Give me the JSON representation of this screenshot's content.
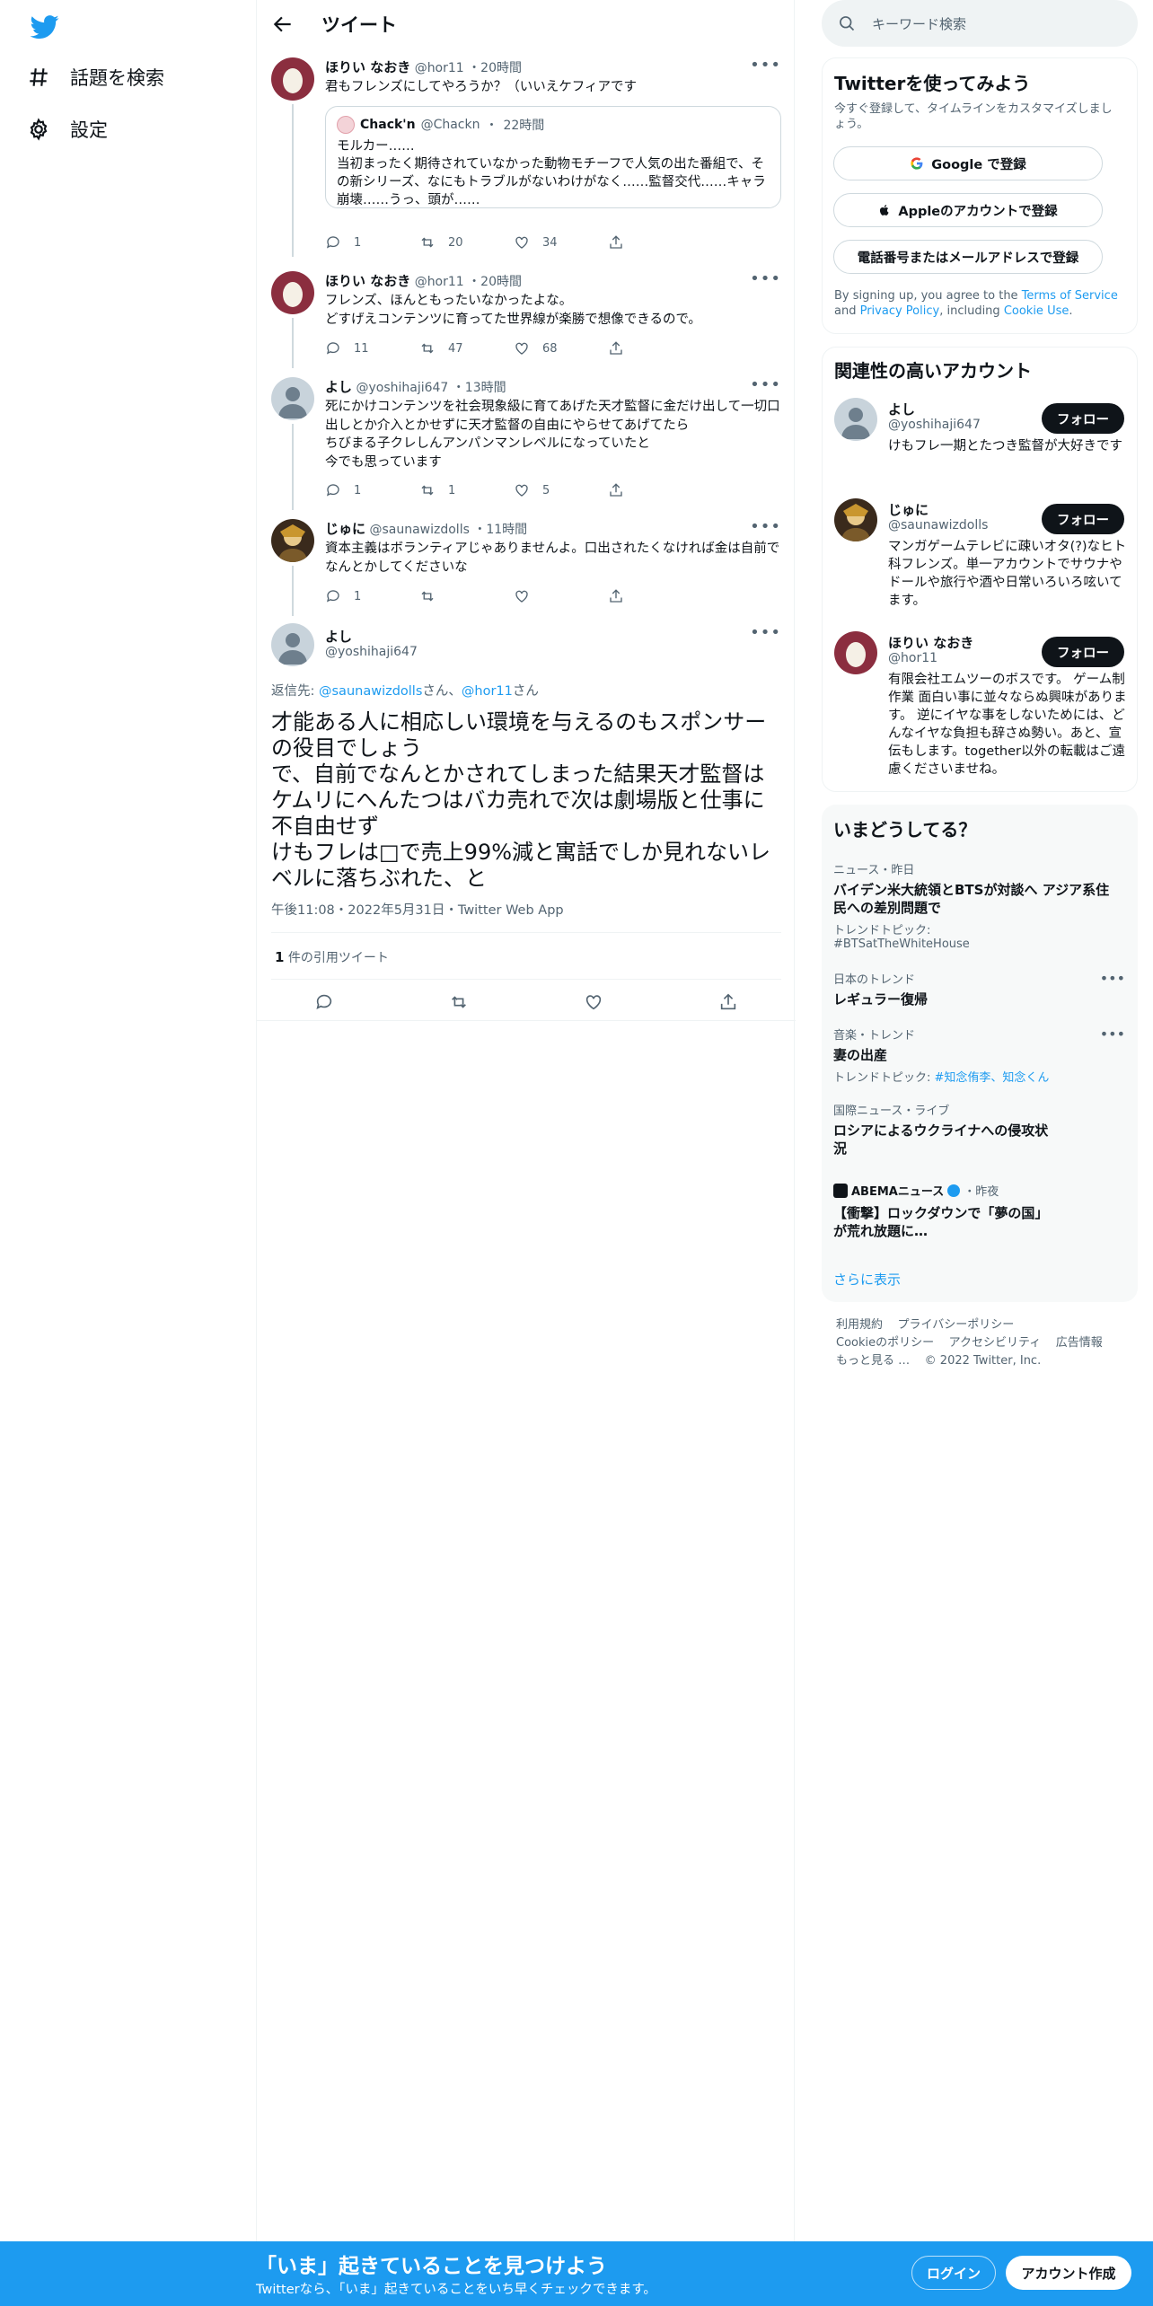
{
  "colors": {
    "accent": "#1d9bf0",
    "text": "#0f1419",
    "muted": "#536471"
  },
  "nav": {
    "items": [
      {
        "label": "話題を検索",
        "icon": "hashtag-icon"
      },
      {
        "label": "設定",
        "icon": "gear-icon"
      }
    ]
  },
  "header": {
    "title": "ツイート"
  },
  "thread": [
    {
      "name": "ほりい なおき",
      "handle": "@hor11",
      "time": "20時間",
      "text": "君もフレンズにしてやろうか？（いいえケフィアです",
      "quote": {
        "name": "Chack'n",
        "handle": "@Chackn",
        "time": "22時間",
        "text": "モルカー……\n当初まったく期待されていなかった動物モチーフで人気の出た番組で、その新シリーズ、なにもトラブルがないわけがなく……監督交代……キャラ崩壊……うっ、頭が……"
      },
      "replies": "1",
      "retweets": "20",
      "likes": "34"
    },
    {
      "name": "ほりい なおき",
      "handle": "@hor11",
      "time": "20時間",
      "text": "フレンズ、ほんともったいなかったよな。\nどすげえコンテンツに育ってた世界線が楽勝で想像できるので。",
      "replies": "11",
      "retweets": "47",
      "likes": "68"
    },
    {
      "name": "よし",
      "handle": "@yoshihaji647",
      "time": "13時間",
      "text": "死にかけコンテンツを社会現象級に育てあげた天才監督に金だけ出して一切口出しとか介入とかせずに天才監督の自由にやらせてあげてたら\nちびまる子クレしんアンパンマンレベルになっていたと\n今でも思っています",
      "replies": "1",
      "retweets": "1",
      "likes": "5"
    },
    {
      "name": "じゅに",
      "handle": "@saunawizdolls",
      "time": "11時間",
      "text": "資本主義はボランティアじゃありませんよ。口出されたくなければ金は自前でなんとかしてくださいな",
      "replies": "1",
      "retweets": "",
      "likes": ""
    }
  ],
  "main_tweet": {
    "name": "よし",
    "handle": "@yoshihaji647",
    "reply_to_prefix": "返信先: ",
    "reply_to_1": "@saunawizdolls",
    "reply_to_mid": "さん、",
    "reply_to_2": "@hor11",
    "reply_to_suffix": "さん",
    "text": "才能ある人に相応しい環境を与えるのもスポンサーの役目でしょう\nで、自前でなんとかされてしまった結果天才監督はケムリにへんたつはバカ売れで次は劇場版と仕事に不自由せず\nけもフレは□で売上99%減と寓話でしか見れないレベルに落ちぶれた、と",
    "timestamp": "午後11:08・2022年5月31日・Twitter Web App",
    "quote_count": "1",
    "quote_label": "件の引用ツイート"
  },
  "search": {
    "placeholder": "キーワード検索"
  },
  "signup_card": {
    "title": "Twitterを使ってみよう",
    "subtitle": "今すぐ登録して、タイムラインをカスタマイズしましょう。",
    "google": "Google で登録",
    "apple": "Appleのアカウントで登録",
    "phone": "電話番号またはメールアドレスで登録",
    "terms_1": "By signing up, you agree to the ",
    "terms_tos": "Terms of Service",
    "terms_2": " and ",
    "terms_privacy": "Privacy Policy",
    "terms_3": ", including ",
    "terms_cookie": "Cookie Use",
    "terms_4": "."
  },
  "relevant": {
    "title": "関連性の高いアカウント",
    "follow_label": "フォロー",
    "accounts": [
      {
        "name": "よし",
        "handle": "@yoshihaji647",
        "bio": "けもフレ一期とたつき監督が大好きです"
      },
      {
        "name": "じゅに",
        "handle": "@saunawizdolls",
        "bio": "マンガゲームテレビに疎いオタ(?)なヒト科フレンズ。単一アカウントでサウナやドールや旅行や酒や日常いろいろ呟いてます。"
      },
      {
        "name": "ほりい なおき",
        "handle": "@hor11",
        "bio": "有限会社エムツーのボスです。 ゲーム制作業 面白い事に並々ならぬ興味があります。 逆にイヤな事をしないためには、どんなイヤな負担も辞さぬ勢い。あと、宣伝もします。together以外の転載はご遠慮くださいませね。"
      }
    ]
  },
  "trends": {
    "title": "いまどうしてる？",
    "items": [
      {
        "category": "ニュース・昨日",
        "name": "バイデン米大統領とBTSが対談へ アジア系住民への差別問題で",
        "topic_label": "トレンドトピック:",
        "topic": "#BTSatTheWhiteHouse"
      },
      {
        "category": "日本のトレンド",
        "name": "レギュラー復帰"
      },
      {
        "category": "音楽・トレンド",
        "name": "妻の出産",
        "topic_label": "トレンドトピック: ",
        "topic": "#知念侑李、知念くん"
      },
      {
        "category": "国際ニュース・ライブ",
        "name": "ロシアによるウクライナへの侵攻状況"
      },
      {
        "source": "ABEMAニュース",
        "time": "・昨夜",
        "name": "【衝撃】ロックダウンで「夢の国」が荒れ放題に…"
      }
    ],
    "show_more": "さらに表示"
  },
  "footer": {
    "links": [
      "利用規約",
      "プライバシーポリシー",
      "Cookieのポリシー",
      "アクセシビリティ",
      "広告情報",
      "もっと見る …"
    ],
    "copyright": "© 2022 Twitter, Inc."
  },
  "bottom_bar": {
    "title": "「いま」起きていることを見つけよう",
    "subtitle": "Twitterなら、「いま」起きていることをいち早くチェックできます。",
    "login": "ログイン",
    "signup": "アカウント作成"
  }
}
